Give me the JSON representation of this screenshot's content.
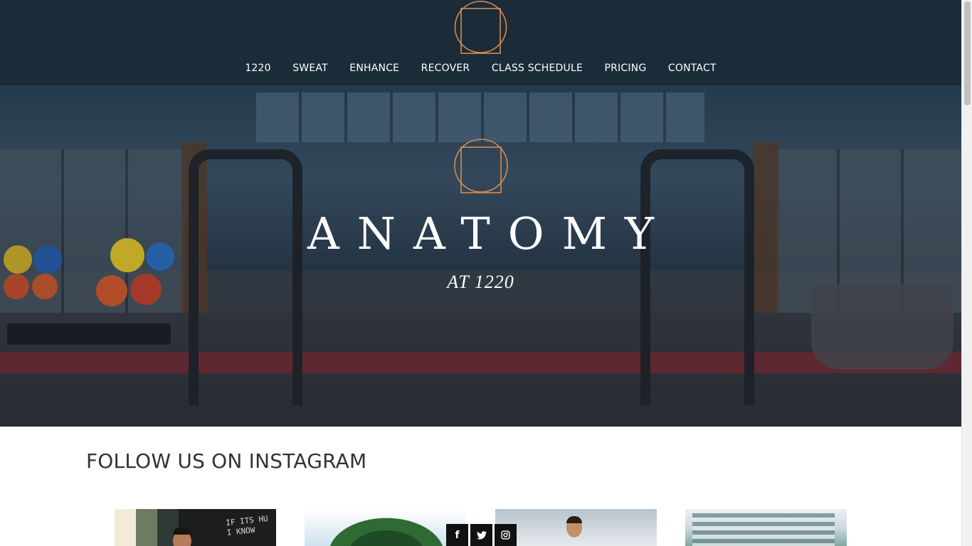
{
  "header": {
    "logo_icon": "square-in-circle-logo-icon",
    "nav": [
      {
        "label": "1220"
      },
      {
        "label": "SWEAT"
      },
      {
        "label": "ENHANCE"
      },
      {
        "label": "RECOVER"
      },
      {
        "label": "CLASS SCHEDULE"
      },
      {
        "label": "PRICING"
      },
      {
        "label": "CONTACT"
      }
    ]
  },
  "hero": {
    "brand": "ANATOMY",
    "subtitle": "AT 1220",
    "logo_icon": "square-in-circle-logo-icon"
  },
  "instagram": {
    "title": "FOLLOW US ON INSTAGRAM",
    "tile1_chalk": "IF ITS HU\nI KNOW"
  },
  "social": {
    "facebook": "f",
    "twitter_icon": "twitter-icon",
    "instagram_icon": "instagram-icon"
  },
  "colors": {
    "accent": "#d98a4c",
    "header_bg": "#1c2c38",
    "nav_text": "#ffffff",
    "title_text": "#333333"
  }
}
